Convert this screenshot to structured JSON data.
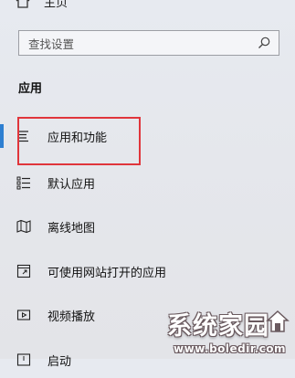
{
  "home": {
    "label": "主页",
    "icon": "home-icon"
  },
  "search": {
    "placeholder": "查找设置",
    "icon": "search-icon"
  },
  "section": {
    "title": "应用"
  },
  "nav": {
    "items": [
      {
        "label": "应用和功能",
        "icon": "apps-features-icon",
        "selected": true
      },
      {
        "label": "默认应用",
        "icon": "default-apps-icon"
      },
      {
        "label": "离线地图",
        "icon": "offline-maps-icon"
      },
      {
        "label": "可使用网站打开的应用",
        "icon": "apps-for-websites-icon"
      },
      {
        "label": "视频播放",
        "icon": "video-playback-icon"
      },
      {
        "label": "启动",
        "icon": "startup-icon"
      }
    ]
  },
  "colors": {
    "accent": "#2e7fd1",
    "highlight": "#e0353b"
  },
  "watermark": {
    "title": "系统家园",
    "url": "www.boledir.com"
  }
}
